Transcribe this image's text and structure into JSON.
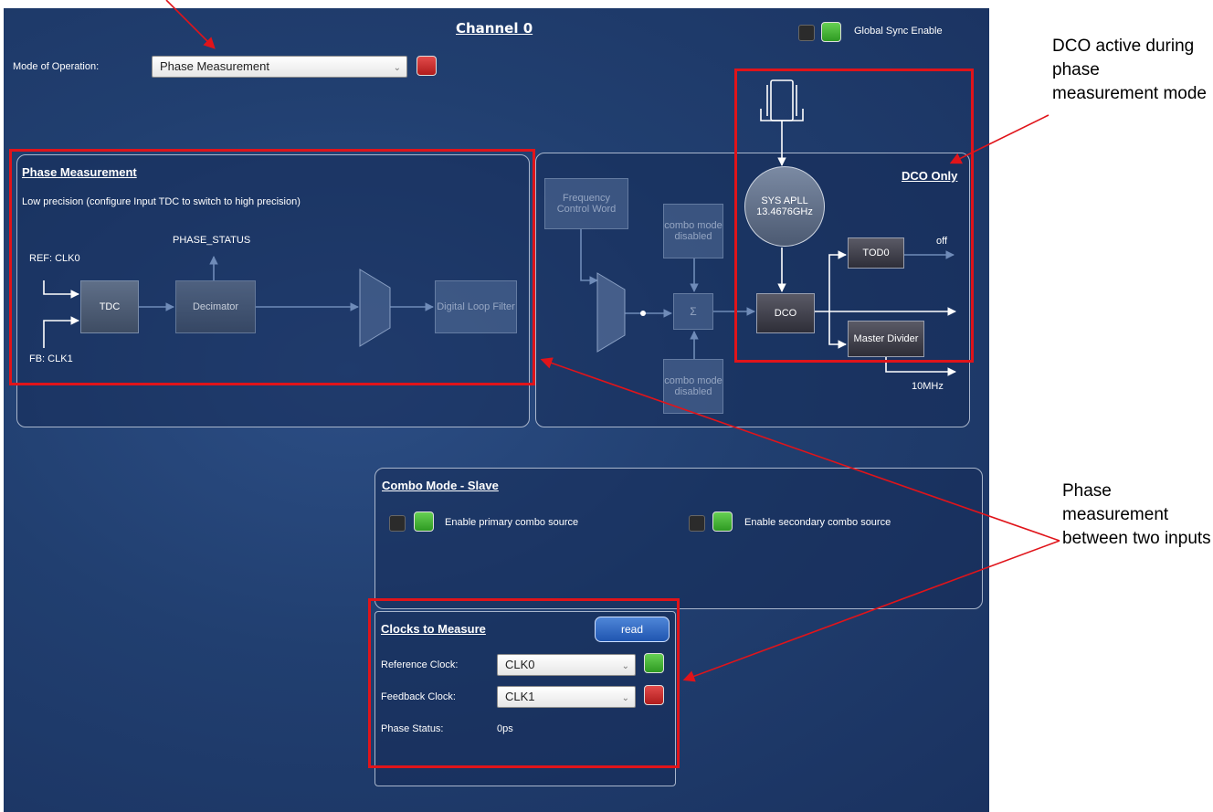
{
  "header": {
    "title": "Channel 0",
    "global_sync_label": "Global Sync Enable"
  },
  "mode": {
    "label": "Mode of Operation:",
    "value": "Phase Measurement"
  },
  "phase_panel": {
    "title": "Phase Measurement",
    "description": "Low precision (configure Input TDC to switch to high precision)",
    "phase_status_label": "PHASE_STATUS",
    "ref_label": "REF: CLK0",
    "fb_label": "FB: CLK1",
    "tdc": "TDC",
    "decimator": "Decimator",
    "loop_filter": "Digital Loop Filter"
  },
  "dco_panel": {
    "title": "DCO Only",
    "freq_word": "Frequency Control Word",
    "combo_top": "combo mode disabled",
    "combo_bottom": "combo mode disabled",
    "sigma": "Σ",
    "sys_apll_line1": "SYS APLL",
    "sys_apll_line2": "13.4676GHz",
    "tod": "TOD0",
    "tod_out": "off",
    "dco": "DCO",
    "master_divider": "Master Divider",
    "out_freq": "10MHz"
  },
  "combo": {
    "title": "Combo Mode - Slave",
    "primary": "Enable primary combo source",
    "secondary": "Enable secondary combo source"
  },
  "clocks": {
    "title": "Clocks to Measure",
    "read_button": "read",
    "ref_label": "Reference Clock:",
    "ref_value": "CLK0",
    "fb_label": "Feedback Clock:",
    "fb_value": "CLK1",
    "status_label": "Phase Status:",
    "status_value": "0ps"
  },
  "annotations": {
    "dco_note": "DCO active during phase measurement mode",
    "phase_note": "Phase measurement between two inputs"
  },
  "colors": {
    "highlight": "#e0141a",
    "panel_bg": "#1f3b6b",
    "lock_red": "#c62828",
    "lock_green": "#3cae2c"
  }
}
